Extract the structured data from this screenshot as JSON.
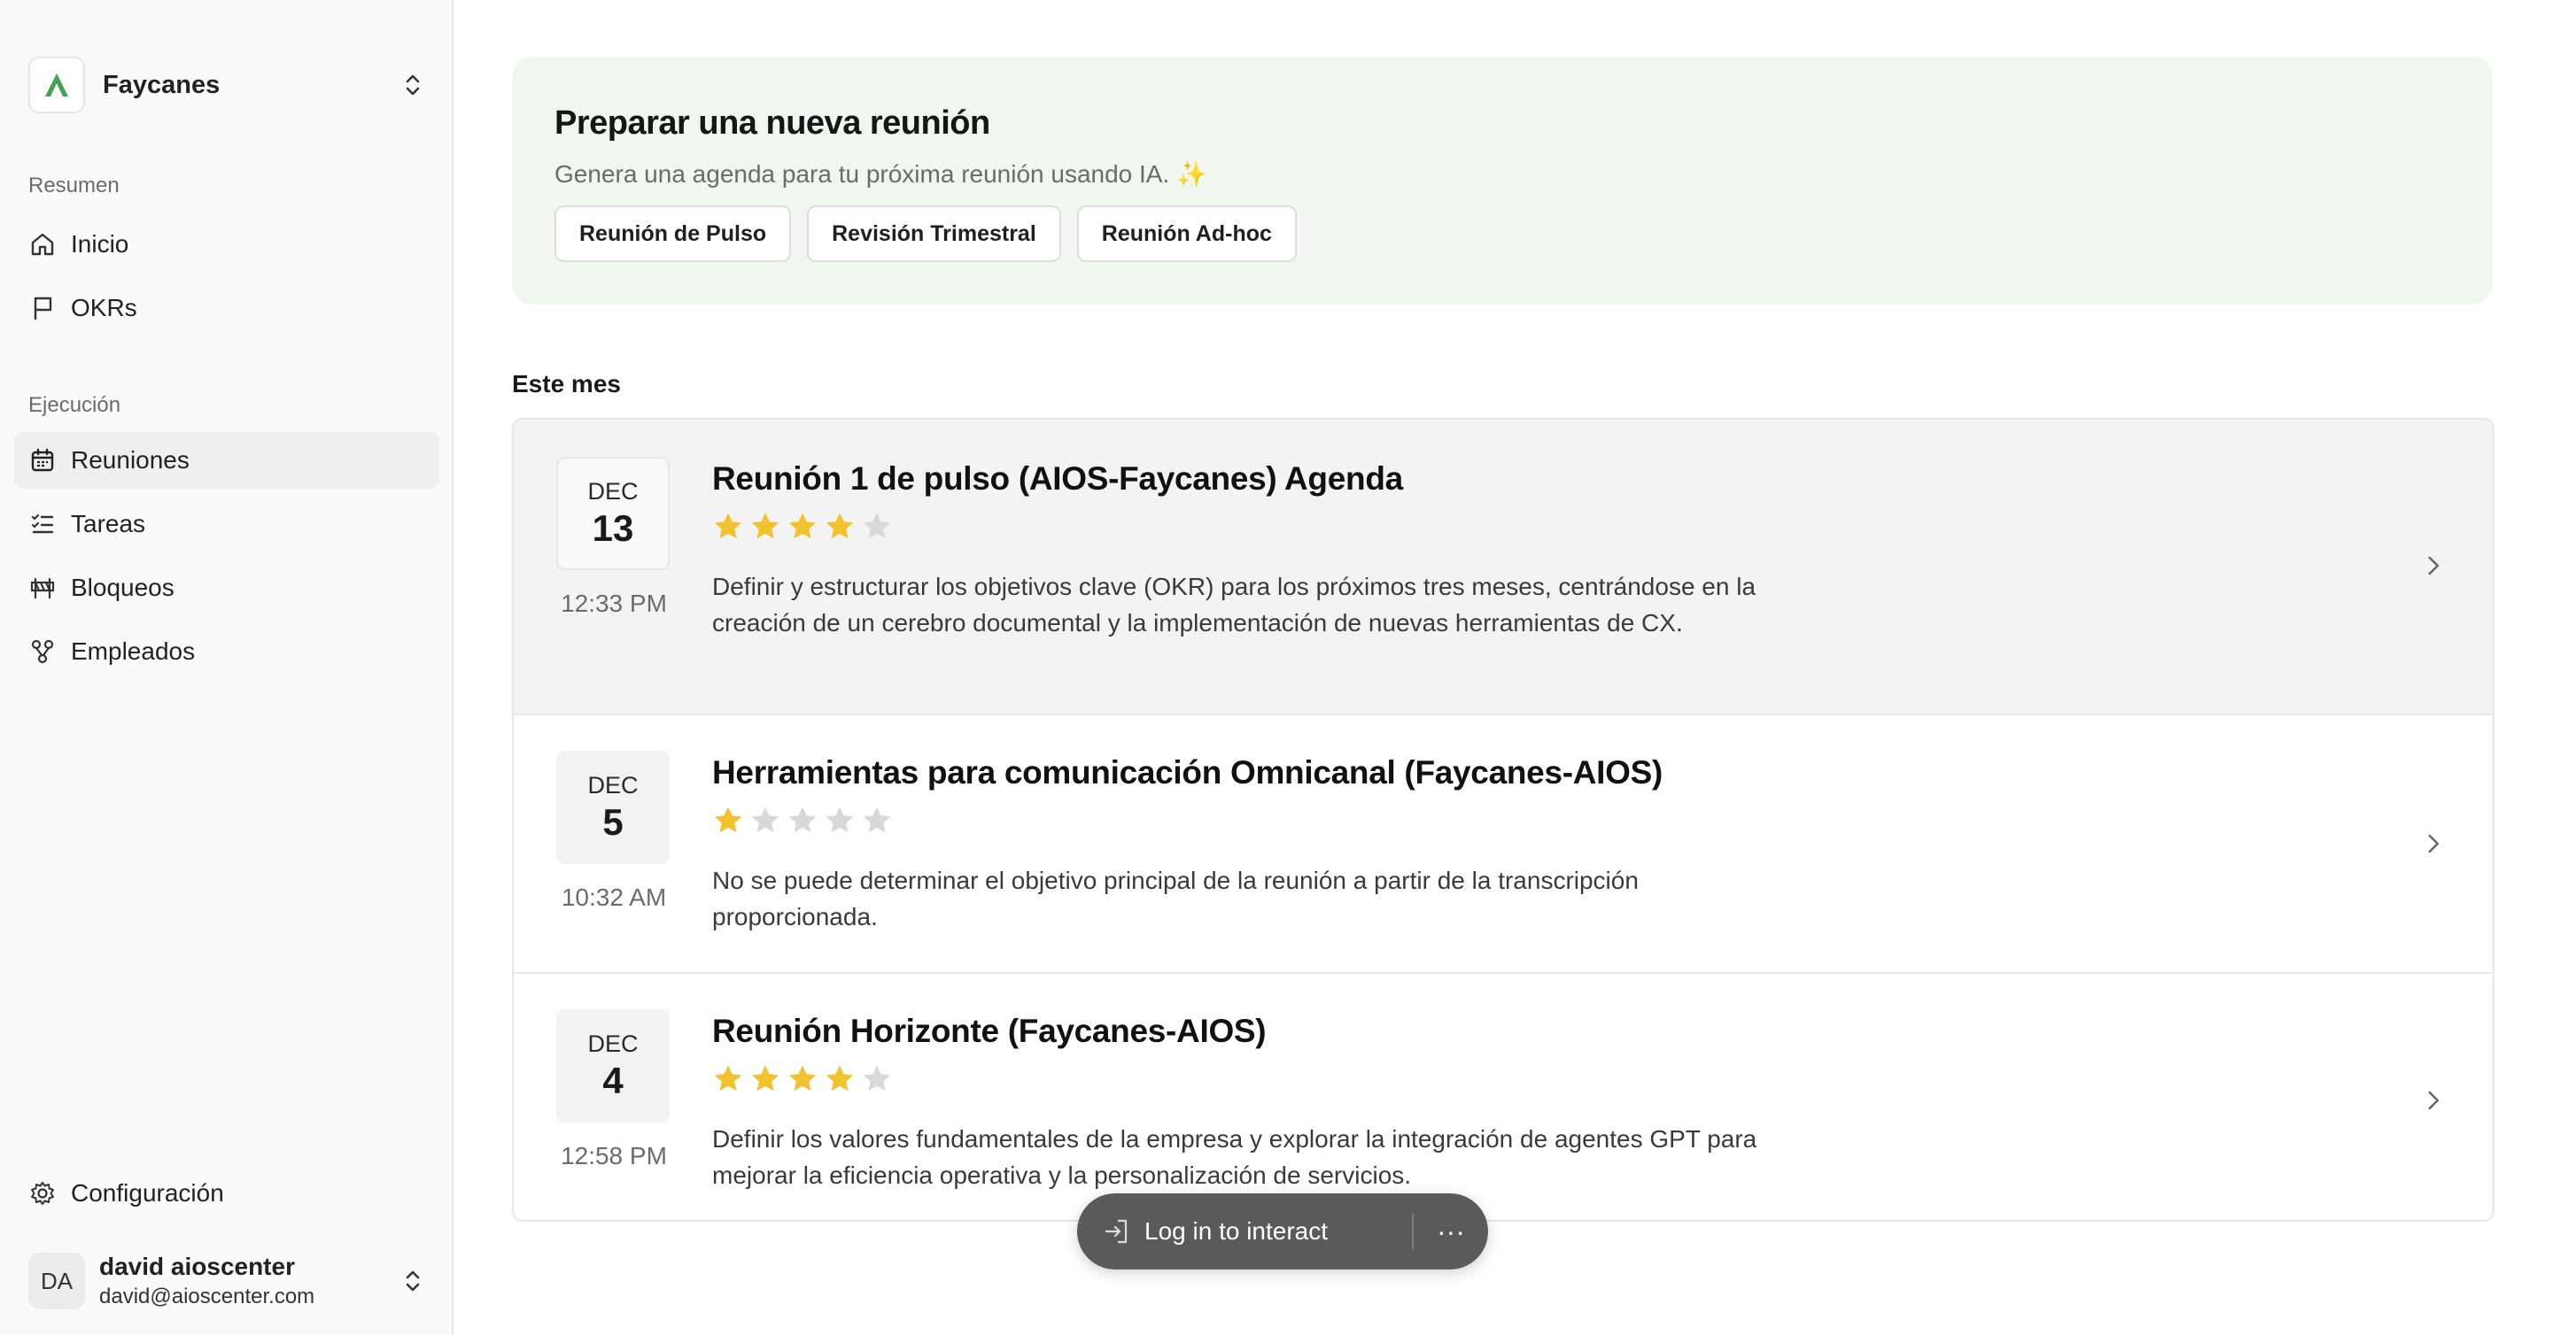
{
  "workspace": {
    "name": "Faycanes"
  },
  "sidebar": {
    "sections": [
      {
        "label": "Resumen",
        "items": [
          {
            "label": "Inicio",
            "icon": "home-icon"
          },
          {
            "label": "OKRs",
            "icon": "flag-icon"
          }
        ]
      },
      {
        "label": "Ejecución",
        "items": [
          {
            "label": "Reuniones",
            "icon": "calendar-icon",
            "active": true
          },
          {
            "label": "Tareas",
            "icon": "list-check-icon"
          },
          {
            "label": "Bloqueos",
            "icon": "roadblock-icon"
          },
          {
            "label": "Empleados",
            "icon": "org-chart-icon"
          }
        ]
      }
    ],
    "settings_label": "Configuración",
    "user": {
      "initials": "DA",
      "name": "david aioscenter",
      "email": "david@aioscenter.com"
    }
  },
  "banner": {
    "title": "Preparar una nueva reunión",
    "subtitle": "Genera una agenda para tu próxima reunión usando IA. ✨",
    "buttons": [
      "Reunión de Pulso",
      "Revisión Trimestral",
      "Reunión Ad-hoc"
    ]
  },
  "meetings_section_label": "Este mes",
  "meetings": [
    {
      "month": "DEC",
      "day": "13",
      "time": "12:33 PM",
      "title": "Reunión 1 de pulso (AIOS-Faycanes) Agenda",
      "rating": 4,
      "rating_max": 5,
      "description": "Definir y estructurar los objetivos clave (OKR) para los próximos tres meses, centrándose en la creación de un cerebro documental y la implementación de nuevas herramientas de CX."
    },
    {
      "month": "DEC",
      "day": "5",
      "time": "10:32 AM",
      "title": "Herramientas para comunicación Omnicanal (Faycanes-AIOS)",
      "rating": 1,
      "rating_max": 5,
      "description": "No se puede determinar el objetivo principal de la reunión a partir de la transcripción proporcionada."
    },
    {
      "month": "DEC",
      "day": "4",
      "time": "12:58 PM",
      "title": "Reunión Horizonte (Faycanes-AIOS)",
      "rating": 4,
      "rating_max": 5,
      "description": "Definir los valores fundamentales de la empresa y explorar la integración de agentes GPT para mejorar la eficiencia operativa y la personalización de servicios."
    }
  ],
  "toast": {
    "login_label": "Log in to interact",
    "more_label": "···"
  },
  "colors": {
    "accent_green": "#3fa34d",
    "star_filled": "#f2c32e",
    "star_empty": "#d9d9dc",
    "banner_bg": "#eff7ee"
  }
}
